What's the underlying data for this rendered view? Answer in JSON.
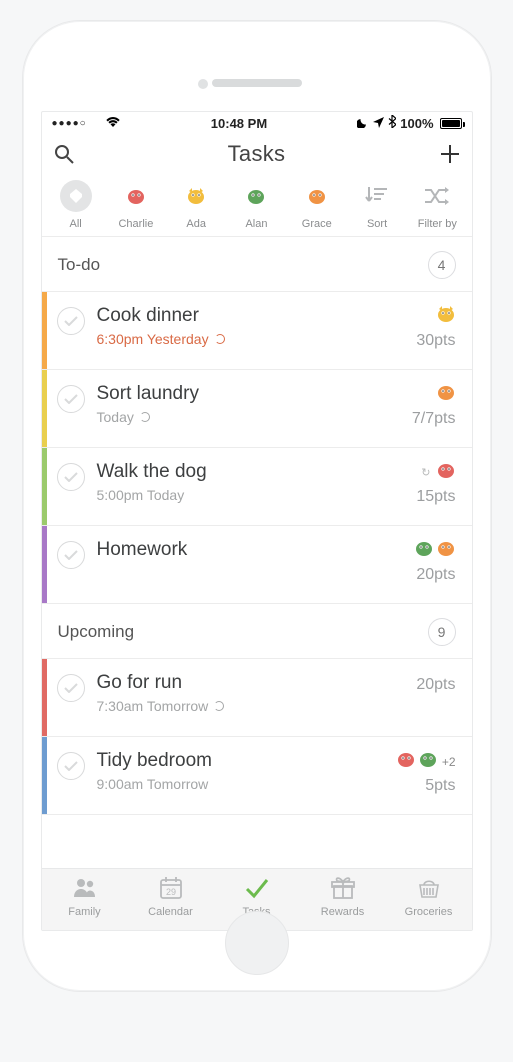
{
  "status": {
    "time": "10:48 PM",
    "battery_pct": "100%",
    "signal_dots": "●●●●○"
  },
  "header": {
    "title": "Tasks"
  },
  "filters": [
    {
      "key": "all",
      "label": "All"
    },
    {
      "key": "charlie",
      "label": "Charlie"
    },
    {
      "key": "ada",
      "label": "Ada"
    },
    {
      "key": "alan",
      "label": "Alan"
    },
    {
      "key": "grace",
      "label": "Grace"
    },
    {
      "key": "sort",
      "label": "Sort"
    },
    {
      "key": "filter",
      "label": "Filter by"
    }
  ],
  "sections": {
    "todo": {
      "title": "To-do",
      "count": "4"
    },
    "upcoming": {
      "title": "Upcoming",
      "count": "9"
    }
  },
  "tasks": {
    "todo": [
      {
        "stripe": "c-orange",
        "name": "Cook dinner",
        "sub": "6:30pm Yesterday",
        "overdue": true,
        "recurring": true,
        "assignees": [
          "ada"
        ],
        "assignees_extra": "",
        "points": "30pts"
      },
      {
        "stripe": "c-yellow",
        "name": "Sort laundry",
        "sub": "Today",
        "overdue": false,
        "recurring": true,
        "assignees": [
          "grace"
        ],
        "assignees_extra": "",
        "points": "7/7pts"
      },
      {
        "stripe": "c-green",
        "name": "Walk the dog",
        "sub": "5:00pm Today",
        "overdue": false,
        "recurring": false,
        "right_recurring": true,
        "assignees": [
          "charlie"
        ],
        "assignees_extra": "",
        "points": "15pts"
      },
      {
        "stripe": "c-purple",
        "name": "Homework",
        "sub": "",
        "overdue": false,
        "recurring": false,
        "assignees": [
          "alan",
          "grace"
        ],
        "assignees_extra": "",
        "points": "20pts"
      }
    ],
    "upcoming": [
      {
        "stripe": "c-red",
        "name": "Go for run",
        "sub": "7:30am Tomorrow",
        "overdue": false,
        "recurring": true,
        "assignees": [],
        "assignees_extra": "",
        "points": "20pts"
      },
      {
        "stripe": "c-blue",
        "name": "Tidy bedroom",
        "sub": "9:00am Tomorrow",
        "overdue": false,
        "recurring": false,
        "assignees": [
          "charlie",
          "alan"
        ],
        "assignees_extra": "+2",
        "points": "5pts"
      }
    ]
  },
  "tabbar": [
    {
      "key": "family",
      "label": "Family"
    },
    {
      "key": "calendar",
      "label": "Calendar",
      "day": "29"
    },
    {
      "key": "tasks",
      "label": "Tasks",
      "active": true
    },
    {
      "key": "rewards",
      "label": "Rewards"
    },
    {
      "key": "groceries",
      "label": "Groceries"
    }
  ],
  "critter_colors": {
    "charlie": "#e3645f",
    "ada": "#f2bd3d",
    "alan": "#5ea45b",
    "grace": "#f09344"
  }
}
